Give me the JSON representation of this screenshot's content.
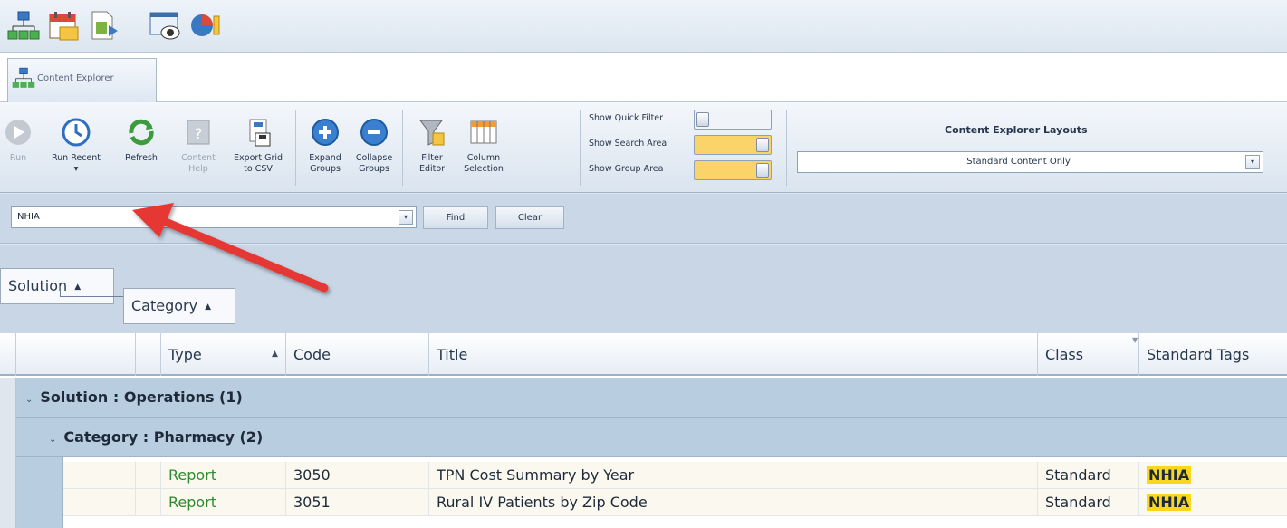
{
  "tab": {
    "label": "Content Explorer"
  },
  "ribbon": {
    "run": "Run",
    "run_recent": "Run Recent",
    "refresh": "Refresh",
    "content_help": "Content\nHelp",
    "export_csv": "Export Grid\nto CSV",
    "expand_groups": "Expand\nGroups",
    "collapse_groups": "Collapse\nGroups",
    "filter_editor": "Filter\nEditor",
    "column_selection": "Column\nSelection",
    "toggles": [
      {
        "label": "Show Quick Filter",
        "on": false
      },
      {
        "label": "Show Search Area",
        "on": true
      },
      {
        "label": "Show Group Area",
        "on": true
      }
    ],
    "layouts_title": "Content Explorer Layouts",
    "layout_value": "Standard Content Only"
  },
  "search": {
    "value": "NHIA",
    "find": "Find",
    "clear": "Clear"
  },
  "group_area": {
    "chips": [
      "Solution",
      "Category"
    ]
  },
  "grid": {
    "columns": [
      "Type",
      "Code",
      "Title",
      "Class",
      "Standard Tags"
    ],
    "groups": [
      {
        "label": "Solution : Operations (1)"
      },
      {
        "label": "Category : Pharmacy (2)"
      }
    ],
    "rows": [
      {
        "type": "Report",
        "code": "3050",
        "title": "TPN Cost Summary by Year",
        "class": "Standard",
        "tags": "NHIA"
      },
      {
        "type": "Report",
        "code": "3051",
        "title": "Rural IV Patients by Zip Code",
        "class": "Standard",
        "tags": "NHIA"
      }
    ]
  },
  "colors": {
    "highlight": "#fad71c",
    "toggle_on": "#fbd469",
    "group_row": "#b8cde0",
    "report_green": "#2e8b2e",
    "arrow": "#e53935"
  },
  "icons": [
    "org-chart-icon",
    "calendar-icon",
    "document-arrow-icon",
    "window-eye-icon",
    "pie-info-icon"
  ]
}
